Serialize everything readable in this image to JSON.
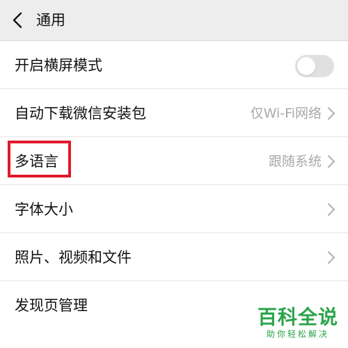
{
  "header": {
    "title": "通用",
    "back_icon": "chevron-left-icon"
  },
  "rows": [
    {
      "label": "开启横屏模式",
      "control": "toggle",
      "toggle_on": false
    },
    {
      "label": "自动下载微信安装包",
      "value": "仅Wi-Fi网络",
      "icon": "chevron-right-icon"
    },
    {
      "label": "多语言",
      "value": "跟随系统",
      "icon": "chevron-right-icon"
    },
    {
      "label": "字体大小",
      "value": "",
      "icon": "chevron-right-icon"
    },
    {
      "label": "照片、视频和文件",
      "value": "",
      "icon": "chevron-right-icon"
    },
    {
      "label": "发现页管理",
      "value": "",
      "icon": ""
    }
  ],
  "highlight": {
    "target": "多语言",
    "color": "#e0192b"
  },
  "watermark": {
    "main": "百科全说",
    "sub": "助你轻松解决",
    "color": "#2aa44a"
  },
  "colors": {
    "header_bg": "#ededed",
    "text": "#111111",
    "secondary_text": "#a8a8a8",
    "toggle_off": "#e0e0e0"
  }
}
